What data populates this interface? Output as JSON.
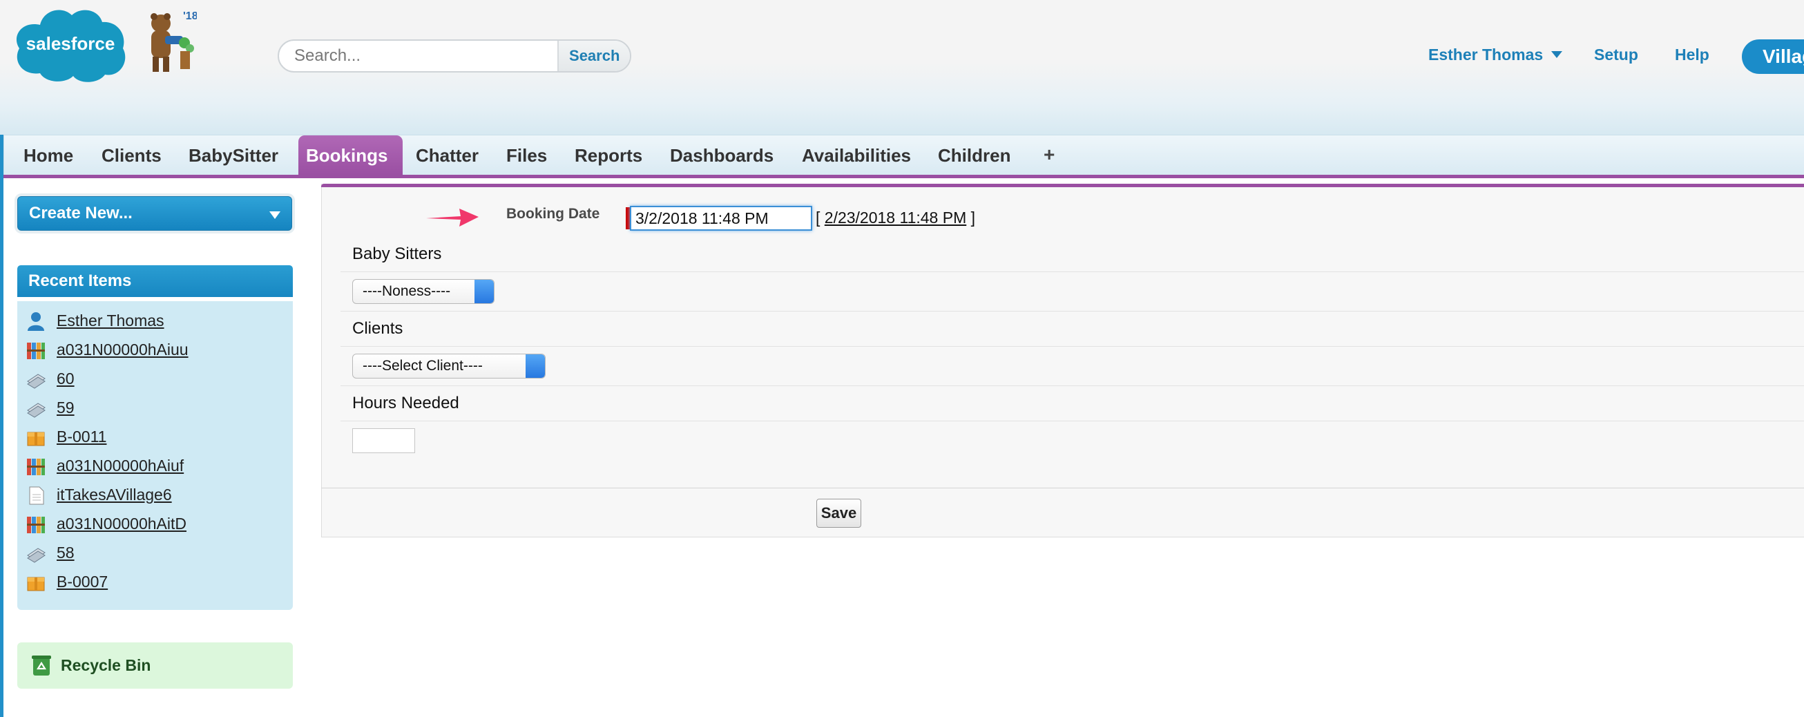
{
  "header": {
    "logo_text": "salesforce",
    "mascot_badge": "'18",
    "search": {
      "placeholder": "Search...",
      "button_label": "Search"
    },
    "user_menu_label": "Esther Thomas",
    "setup_label": "Setup",
    "help_label": "Help",
    "app_menu_label": "Village"
  },
  "tabs": [
    {
      "label": "Home"
    },
    {
      "label": "Clients"
    },
    {
      "label": "BabySitter"
    },
    {
      "label": "Bookings"
    },
    {
      "label": "Chatter"
    },
    {
      "label": "Files"
    },
    {
      "label": "Reports"
    },
    {
      "label": "Dashboards"
    },
    {
      "label": "Availabilities"
    },
    {
      "label": "Children"
    },
    {
      "label": "+"
    }
  ],
  "active_tab": "Bookings",
  "sidebar": {
    "create_new_label": "Create New...",
    "recent_items_title": "Recent Items",
    "recent_items": [
      {
        "label": "Esther Thomas",
        "icon": "person-icon"
      },
      {
        "label": "a031N00000hAiuu",
        "icon": "books-icon"
      },
      {
        "label": "60",
        "icon": "stack-icon"
      },
      {
        "label": "59",
        "icon": "stack-icon"
      },
      {
        "label": "B-0011",
        "icon": "box-icon"
      },
      {
        "label": "a031N00000hAiuf",
        "icon": "books-icon"
      },
      {
        "label": "itTakesAVillage6",
        "icon": "document-icon"
      },
      {
        "label": "a031N00000hAitD",
        "icon": "books-icon"
      },
      {
        "label": "58",
        "icon": "stack-icon"
      },
      {
        "label": "B-0007",
        "icon": "box-icon"
      }
    ],
    "recycle_bin_label": "Recycle Bin"
  },
  "form": {
    "booking_date_label": "Booking Date",
    "booking_date_value": "3/2/2018 11:48 PM",
    "today_link": "2/23/2018 11:48 PM",
    "bracket_open": "[",
    "bracket_close": "]",
    "baby_sitters_label": "Baby Sitters",
    "baby_sitters_selected": "----Noness----",
    "clients_label": "Clients",
    "clients_selected": "----Select Client----",
    "hours_needed_label": "Hours Needed",
    "hours_needed_value": "",
    "save_label": "Save"
  },
  "colors": {
    "brand_blue": "#1b8cc9",
    "active_tab_purple": "#9a4fa2",
    "required_red": "#cc0000",
    "recent_panel_bg": "#cfeaf4",
    "recycle_bg": "#dcf7dc",
    "arrow_pink": "#f0386b"
  }
}
